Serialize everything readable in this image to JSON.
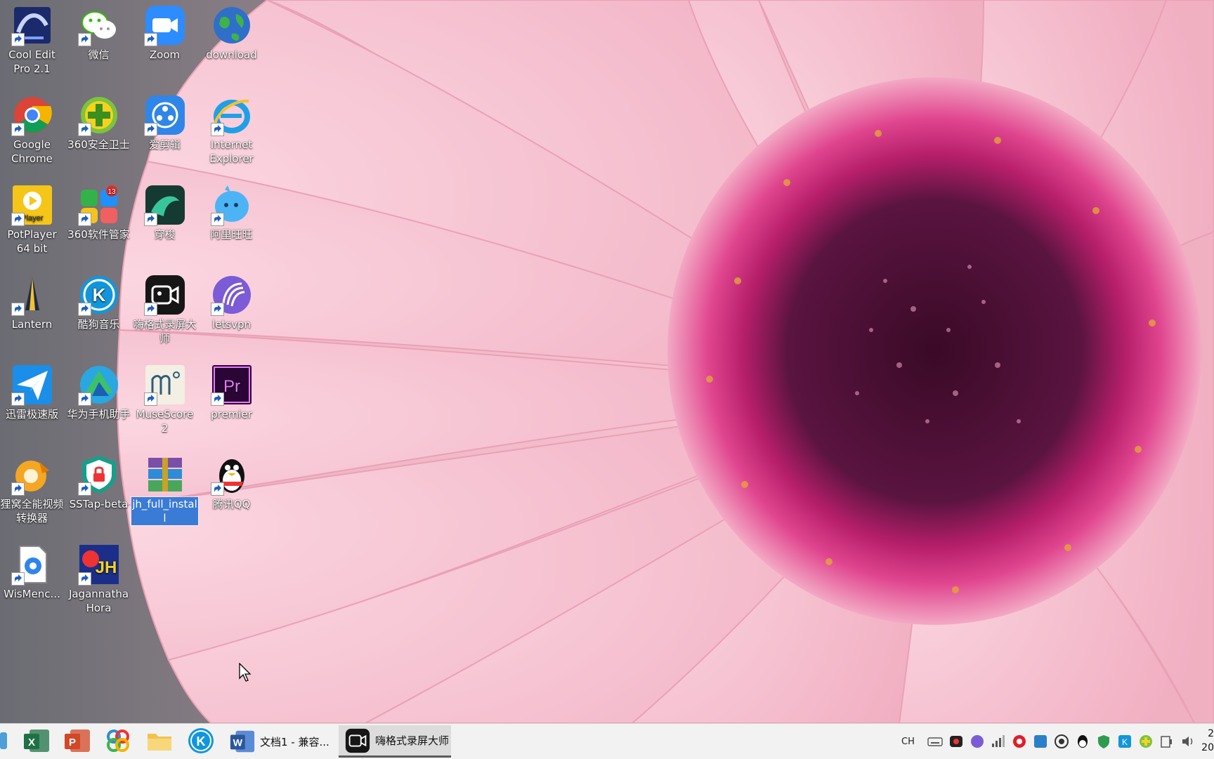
{
  "desktop": {
    "icons": [
      {
        "label": "Cool Edit Pro 2.1",
        "icon": "cool-edit-icon"
      },
      {
        "label": "微信",
        "icon": "wechat-icon"
      },
      {
        "label": "Zoom",
        "icon": "zoom-icon"
      },
      {
        "label": "download",
        "icon": "globe-icon"
      },
      {
        "label": "Google Chrome",
        "icon": "chrome-icon"
      },
      {
        "label": "360安全卫士",
        "icon": "360-security-icon"
      },
      {
        "label": "爱剪辑",
        "icon": "film-reel-icon"
      },
      {
        "label": "Internet Explorer",
        "icon": "internet-explorer-icon"
      },
      {
        "label": "PotPlayer 64 bit",
        "icon": "potplayer-icon"
      },
      {
        "label": "360软件管家",
        "icon": "360-software-manager-icon",
        "badge": "13"
      },
      {
        "label": "穿梭",
        "icon": "shuttle-icon"
      },
      {
        "label": "阿里旺旺",
        "icon": "aliwangwang-icon"
      },
      {
        "label": "Lantern",
        "icon": "lantern-icon"
      },
      {
        "label": "酷狗音乐",
        "icon": "kugou-icon"
      },
      {
        "label": "嗨格式录屏大师",
        "icon": "screen-recorder-icon"
      },
      {
        "label": "letsvpn",
        "icon": "letsvpn-icon"
      },
      {
        "label": "迅雷极速版",
        "icon": "xunlei-icon"
      },
      {
        "label": "华为手机助手",
        "icon": "huawei-assistant-icon"
      },
      {
        "label": "MuseScore 2",
        "icon": "musescore-icon"
      },
      {
        "label": "premier",
        "icon": "premiere-icon"
      },
      {
        "label": "狸窝全能视频转换器",
        "icon": "video-converter-icon"
      },
      {
        "label": "SSTap-beta",
        "icon": "sstap-shield-icon"
      },
      {
        "label": "jh_full_install",
        "icon": "winrar-archive-icon",
        "selected": true
      },
      {
        "label": "腾讯QQ",
        "icon": "qq-penguin-icon"
      },
      {
        "label": "WisMenc...",
        "icon": "document-gear-icon"
      },
      {
        "label": "Jagannatha Hora",
        "icon": "jagannatha-hora-icon"
      }
    ]
  },
  "taskbar": {
    "pinned": [
      {
        "name": "excel-icon",
        "letter": "X",
        "color": "#1e7145"
      },
      {
        "name": "powerpoint-icon",
        "letter": "P",
        "color": "#d24726"
      },
      {
        "name": "photos-icon"
      },
      {
        "name": "folder-icon"
      },
      {
        "name": "kugou-icon",
        "letter": "K",
        "color": "#1296db"
      }
    ],
    "windows": [
      {
        "label": "文档1 - 兼容...",
        "icon": "word-icon",
        "letter": "W",
        "color": "#2b579a",
        "active": false
      },
      {
        "label": "嗨格式录屏大师",
        "icon": "screen-recorder-icon",
        "active": true
      }
    ],
    "tray": {
      "language": "CH"
    },
    "clock": {
      "line1": "2",
      "line2": "20"
    }
  },
  "colors": {
    "petal": "#f6bfcd",
    "flower_center": "#4a0f33",
    "stamen": "#d6307f",
    "taskbar": "#f2f2f2",
    "selection": "#3a7bd5"
  }
}
